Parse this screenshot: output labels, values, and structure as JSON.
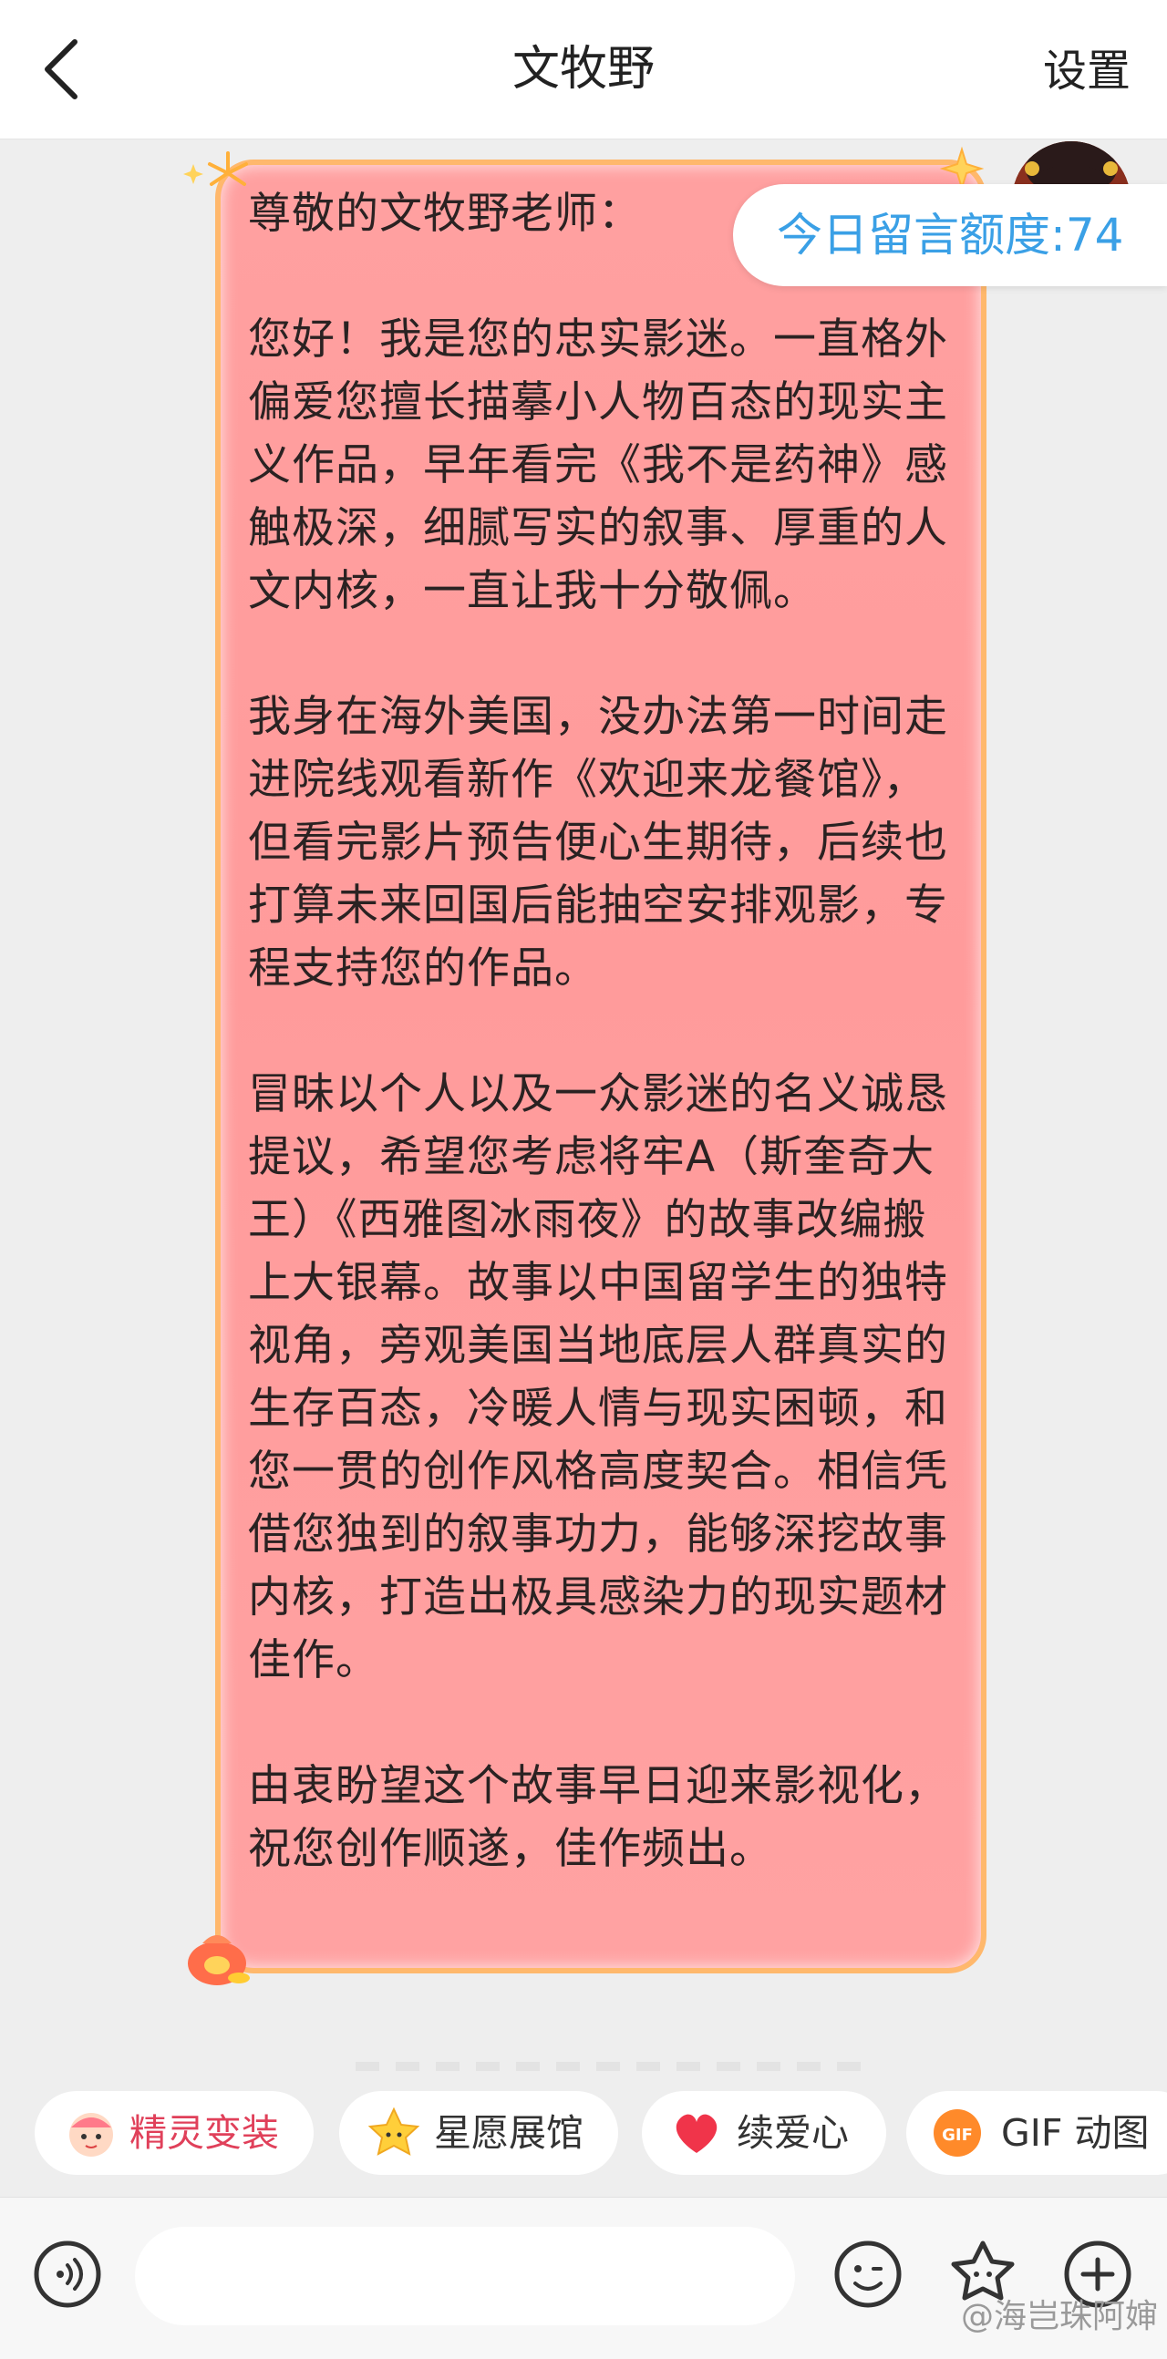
{
  "header": {
    "title": "文牧野",
    "settings_label": "设置"
  },
  "quota": {
    "label": "今日留言额度:74"
  },
  "message": {
    "greeting": "尊敬的文牧野老师：",
    "p1": "您好！我是您的忠实影迷。一直格外偏爱您擅长描摹小人物百态的现实主义作品，早年看完《我不是药神》感触极深，细腻写实的叙事、厚重的人文内核，一直让我十分敬佩。",
    "p2": "我身在海外美国，没办法第一时间走进院线观看新作《欢迎来龙餐馆》，但看完影片预告便心生期待，后续也打算未来回国后能抽空安排观影，专程支持您的作品。",
    "p3": "冒昧以个人以及一众影迷的名义诚恳提议，希望您考虑将牢A（斯奎奇大王）《西雅图冰雨夜》的故事改编搬上大银幕。故事以中国留学生的独特视角，旁观美国当地底层人群真实的生存百态，冷暖人情与现实困顿，和您一贯的创作风格高度契合。相信凭借您独到的叙事功力，能够深挖故事内核，打造出极具感染力的现实题材佳作。",
    "p4": "由衷盼望这个故事早日迎来影视化，祝您创作顺遂，佳作频出。"
  },
  "chips": [
    {
      "label": "精灵变装",
      "icon": "sprite-icon",
      "color": "#e0405a"
    },
    {
      "label": "星愿展馆",
      "icon": "star-icon",
      "color": "#333333"
    },
    {
      "label": "续爱心",
      "icon": "heart-icon",
      "color": "#333333"
    },
    {
      "label": "GIF 动图",
      "icon": "gif-icon",
      "color": "#333333"
    }
  ],
  "bottom_bar": {
    "input_placeholder": "",
    "icons": [
      "voice-icon",
      "emoji-icon",
      "sticker-icon",
      "plus-icon"
    ]
  },
  "watermark": "@海岂珠阿婶",
  "colors": {
    "bubble_fill": "#ffa0a0",
    "bubble_border": "#ffb86c",
    "quota_text": "#3aa0e6",
    "accent_red": "#e0405a"
  }
}
